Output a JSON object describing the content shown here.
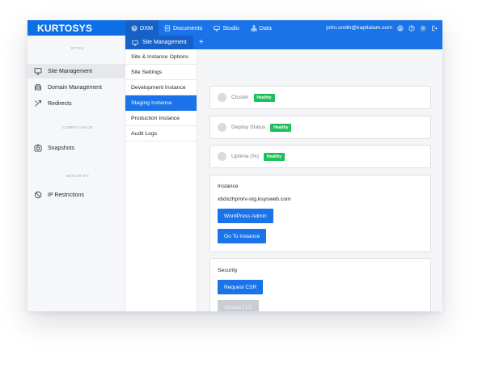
{
  "brand": {
    "logo": "KURTOSYS"
  },
  "topnav": {
    "items": [
      {
        "label": "DXM",
        "icon": "layers-icon"
      },
      {
        "label": "Documents",
        "icon": "document-icon"
      },
      {
        "label": "Studio",
        "icon": "monitor-icon"
      },
      {
        "label": "Data",
        "icon": "hierarchy-icon"
      }
    ],
    "user_email": "john.smith@kapitalam.com"
  },
  "subbar": {
    "tab_label": "Site Management",
    "add_label": "+"
  },
  "sidebar": {
    "sections": {
      "sites": "SITES",
      "compliance": "COMPLIANCE",
      "security": "SECURITY"
    },
    "items": [
      {
        "label": "Site Management",
        "icon": "monitor-icon"
      },
      {
        "label": "Domain Management",
        "icon": "storage-icon"
      },
      {
        "label": "Redirects",
        "icon": "redirect-icon"
      },
      {
        "label": "Snapshots",
        "icon": "camera-icon"
      },
      {
        "label": "IP Restrictions",
        "icon": "block-icon"
      }
    ]
  },
  "subnav": {
    "items": [
      {
        "label": "Site & Instance Options"
      },
      {
        "label": "Site Settings"
      },
      {
        "label": "Development Instance"
      },
      {
        "label": "Staging Instance"
      },
      {
        "label": "Production Instance"
      },
      {
        "label": "Audit Logs"
      }
    ]
  },
  "main": {
    "statuses": [
      {
        "label": "Cluster",
        "badge": "Healthy"
      },
      {
        "label": "Deploy Status",
        "badge": "Healthy"
      },
      {
        "label": "Uptime (%)",
        "badge": "Healthy"
      }
    ],
    "instance": {
      "title": "Instance",
      "host": "xbdxzhpmrv-stg.ksysweb.com",
      "wp_admin_label": "WordPress Admin",
      "go_label": "Go To Instance"
    },
    "security": {
      "title": "Security",
      "csr_label": "Request CSR",
      "tls_label": "Upload TLS"
    }
  },
  "colors": {
    "primary": "#1a73e8",
    "success": "#1ec05a",
    "disabled": "#c9cdd4"
  }
}
